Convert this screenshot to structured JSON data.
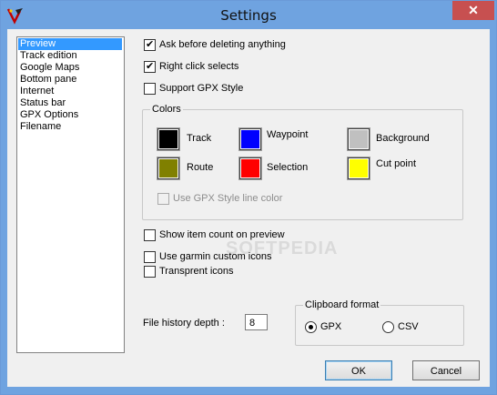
{
  "window": {
    "title": "Settings",
    "close_glyph": "✕"
  },
  "sidebar": {
    "items": [
      {
        "label": "Preview",
        "selected": true
      },
      {
        "label": "Track edition"
      },
      {
        "label": "Google Maps"
      },
      {
        "label": "Bottom pane"
      },
      {
        "label": "Internet"
      },
      {
        "label": "Status bar"
      },
      {
        "label": "GPX Options"
      },
      {
        "label": "Filename"
      }
    ]
  },
  "options": {
    "ask_delete": {
      "label": "Ask before deleting anything",
      "checked": true
    },
    "right_click": {
      "label": "Right click selects",
      "checked": true
    },
    "support_gpx": {
      "label": "Support GPX Style",
      "checked": false
    },
    "show_count": {
      "label": "Show item count on preview",
      "checked": false
    },
    "garmin_icons": {
      "label": "Use garmin custom icons",
      "checked": false
    },
    "transparent_icons": {
      "label": "Transprent icons",
      "checked": false
    }
  },
  "colors": {
    "title": "Colors",
    "track": {
      "label": "Track",
      "color": "#000000"
    },
    "waypoint": {
      "label": "Waypoint",
      "color": "#0000ff"
    },
    "background": {
      "label": "Background",
      "color": "#c0c0c0"
    },
    "route": {
      "label": "Route",
      "color": "#808000"
    },
    "selection": {
      "label": "Selection",
      "color": "#ff0000"
    },
    "cut_point": {
      "label": "Cut point",
      "color": "#ffff00"
    },
    "gpx_line_color": {
      "label": "Use GPX Style line color",
      "checked": false,
      "disabled": true
    }
  },
  "history": {
    "label": "File history depth :",
    "value": "8"
  },
  "clipboard": {
    "title": "Clipboard format",
    "gpx": {
      "label": "GPX",
      "selected": true
    },
    "csv": {
      "label": "CSV",
      "selected": false
    }
  },
  "buttons": {
    "ok": "OK",
    "cancel": "Cancel"
  },
  "watermark": "SOFTPEDIA"
}
